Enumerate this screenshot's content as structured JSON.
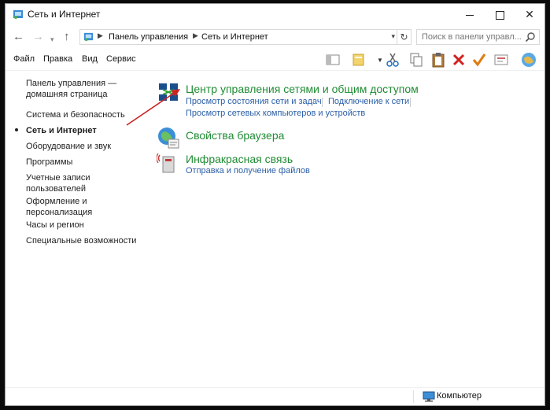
{
  "window": {
    "title": "Сеть и Интернет"
  },
  "address_bar": {
    "crumbs": [
      "Панель управления",
      "Сеть и Интернет"
    ],
    "search_placeholder": "Поиск в панели управл..."
  },
  "menu": {
    "items": [
      "Файл",
      "Правка",
      "Вид",
      "Сервис"
    ]
  },
  "toolbar": {
    "icons": [
      "view-pane-icon",
      "folder-options-icon",
      "cut-icon",
      "copy-icon",
      "paste-icon",
      "delete-icon",
      "checkmark-icon",
      "properties-icon",
      "globe-icon"
    ]
  },
  "left_pane": {
    "home_line1": "Панель управления —",
    "home_line2": "домашняя страница",
    "items": [
      "Система и безопасность",
      "Сеть и Интернет",
      "Оборудование и звук",
      "Программы",
      "Учетные записи",
      "пользователей",
      "Оформление и",
      "персонализация",
      "Часы и регион",
      "Специальные возможности"
    ],
    "current": "Сеть и Интернет"
  },
  "categories": [
    {
      "title": "Центр управления сетями и общим доступом",
      "links": [
        "Просмотр состояния сети и задач",
        "Подключение к сети",
        "Просмотр сетевых компьютеров и устройств"
      ]
    },
    {
      "title": "Свойства браузера",
      "links": []
    },
    {
      "title": "Инфракрасная связь",
      "links": [
        "Отправка и получение файлов"
      ]
    }
  ],
  "status_bar": {
    "text": "Компьютер"
  },
  "colors": {
    "category_title": "#1f8c33",
    "link": "#2b5fa7",
    "annotation_arrow": "#cc2222"
  }
}
